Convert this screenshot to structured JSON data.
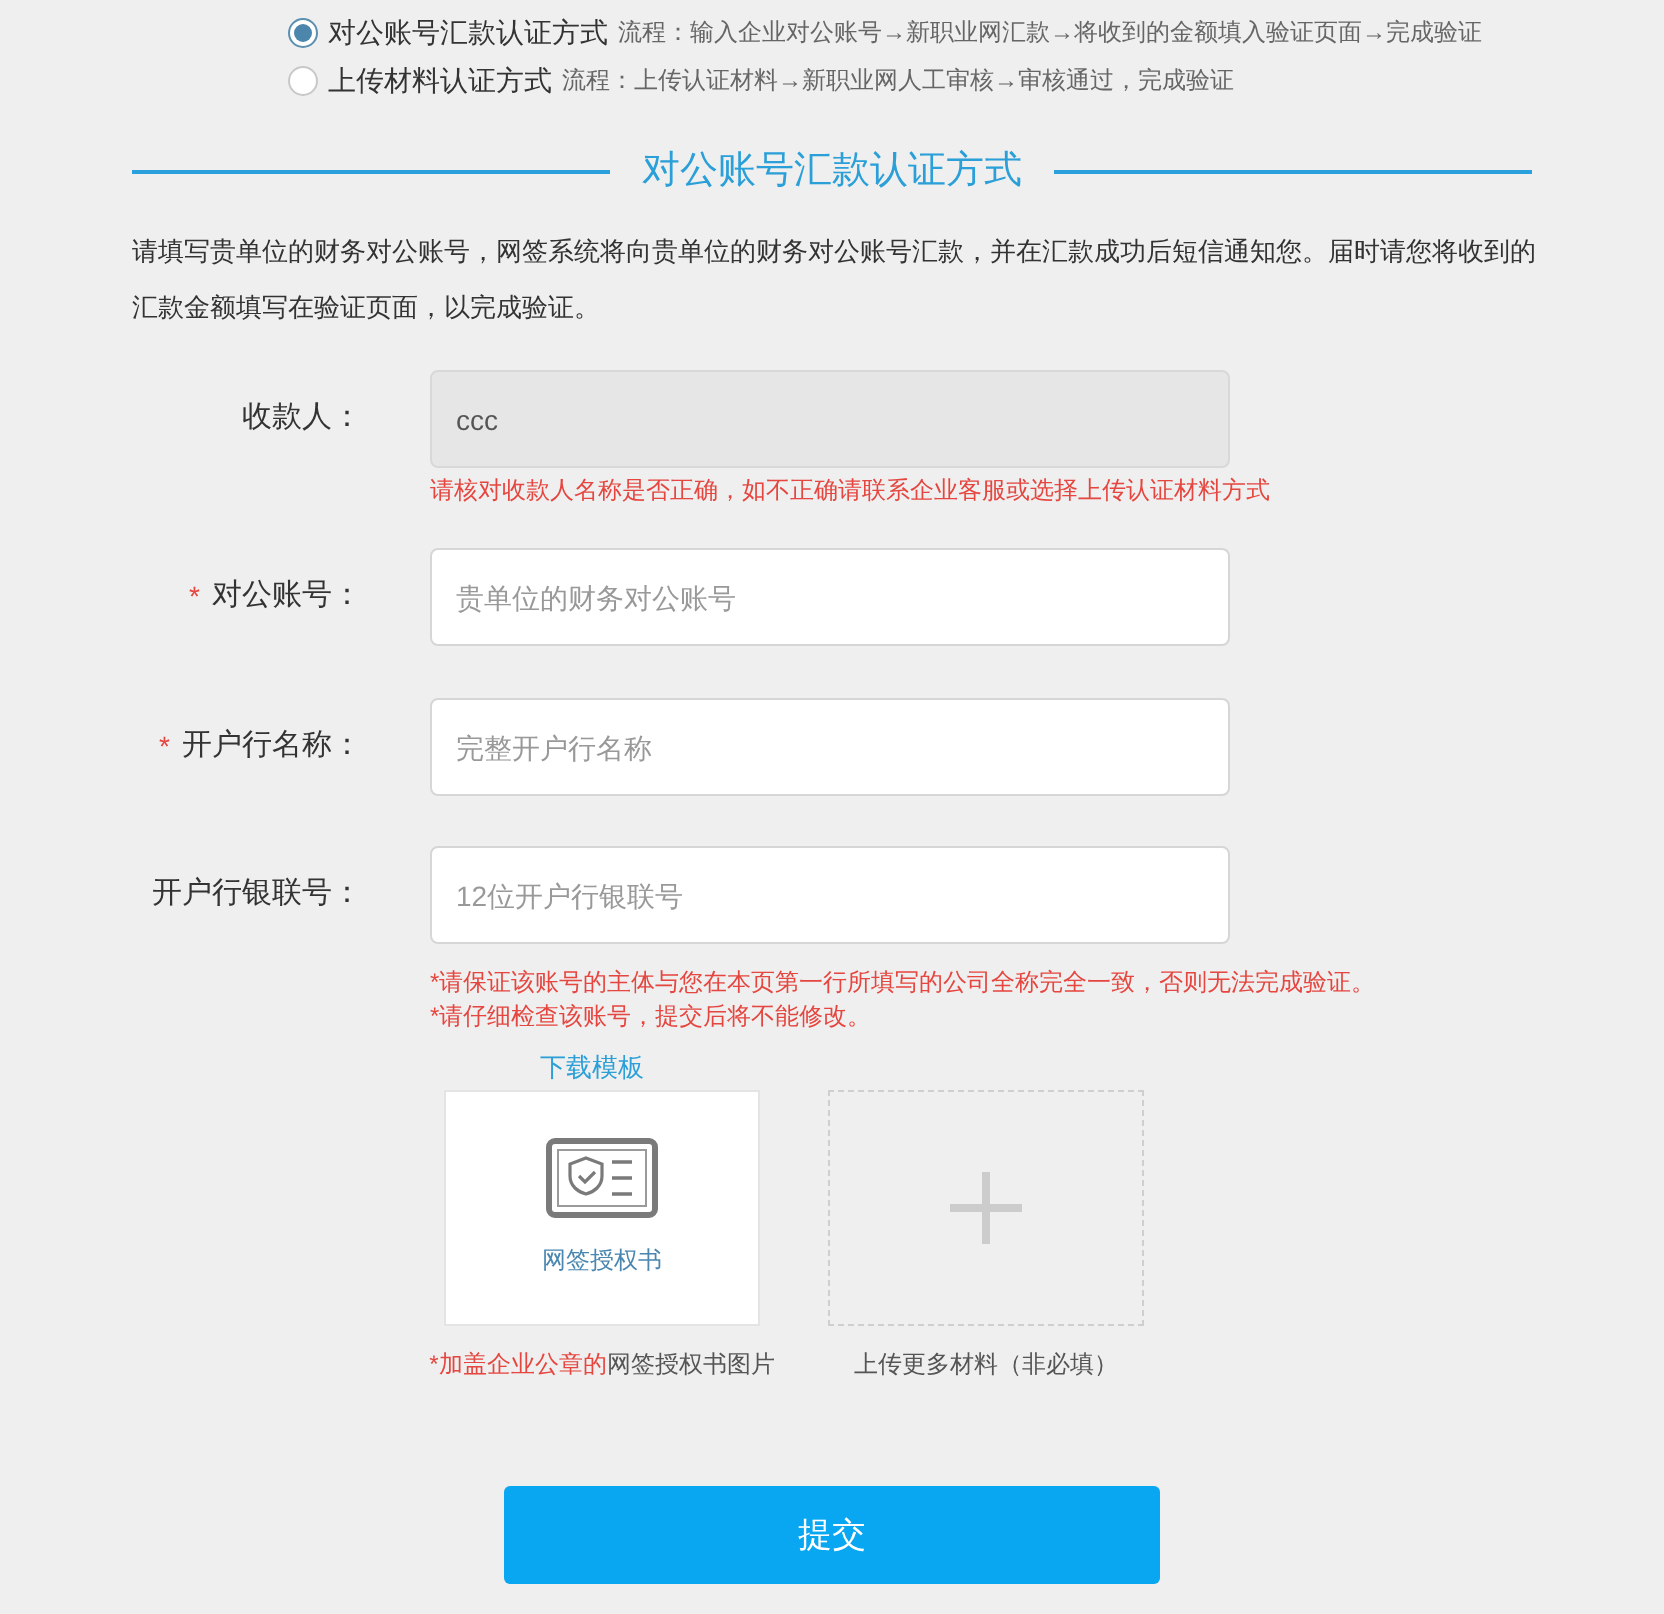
{
  "methods": [
    {
      "label": "对公账号汇款认证方式",
      "flow": "流程：输入企业对公账号→新职业网汇款→将收到的金额填入验证页面→完成验证",
      "selected": true
    },
    {
      "label": "上传材料认证方式",
      "flow": "流程：上传认证材料→新职业网人工审核→审核通过，完成验证",
      "selected": false
    }
  ],
  "section_title": "对公账号汇款认证方式",
  "intro": "请填写贵单位的财务对公账号，网签系统将向贵单位的财务对公账号汇款，并在汇款成功后短信通知您。届时请您将收到的汇款金额填写在验证页面，以完成验证。",
  "fields": [
    {
      "label": "收款人：",
      "disabled": true,
      "value": "ccc",
      "error": "请核对收款人名称是否正确，如不正确请联系企业客服或选择上传认证材料方式"
    },
    {
      "label": "对公账号：",
      "required_mark": "*",
      "disabled": false,
      "placeholder": "贵单位的财务对公账号"
    },
    {
      "label": "开户行名称：",
      "required_mark": "*",
      "disabled": false,
      "placeholder": "完整开户行名称"
    },
    {
      "label": "开户行银联号：",
      "disabled": false,
      "placeholder": "12位开户行银联号"
    }
  ],
  "notes": [
    "*请保证该账号的主体与您在本页第一行所填写的公司全称完全一致，否则无法完成验证。",
    "*请仔细检查该账号，提交后将不能修改。"
  ],
  "download_link": "下载模板",
  "uploads": [
    {
      "kind": "template",
      "card_label": "网签授权书",
      "caption_highlight": "*加盖企业公章的",
      "caption": "网签授权书图片"
    },
    {
      "kind": "add",
      "caption": "上传更多材料（非必填）"
    }
  ],
  "submit": "提交"
}
